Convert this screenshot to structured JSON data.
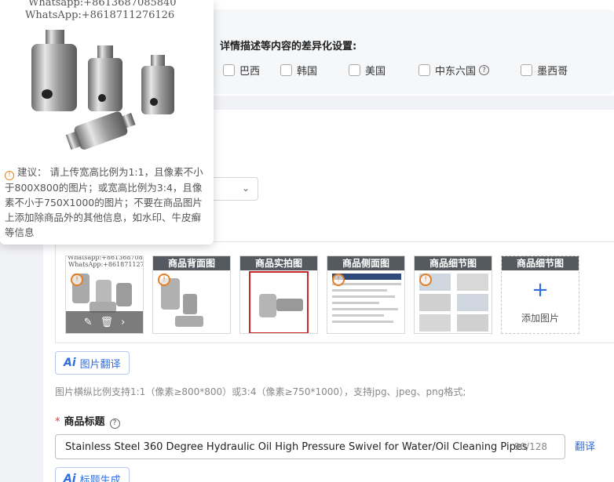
{
  "watermark": {
    "top": "Whatsapp:+8613687085840",
    "line": "WhatsApp:+8618711276126"
  },
  "tooltip": {
    "text": "建议： 请上传宽高比例为1:1，且像素不小于800X800的图片；或宽高比例为3:4，且像素不小于750X1000的图片；不要在商品图片上添加除商品外的其他信息，如水印、牛皮癣等信息"
  },
  "country_section": {
    "title": "详情描述等内容的差异化设置:",
    "options": [
      {
        "label": "巴西",
        "checked": false
      },
      {
        "label": "韩国",
        "checked": false
      },
      {
        "label": "美国",
        "checked": false
      },
      {
        "label": "中东六国",
        "checked": false,
        "help": true
      },
      {
        "label": "墨西哥",
        "checked": false
      }
    ]
  },
  "gallery": {
    "thumbs": [
      {
        "label": "",
        "type": "main"
      },
      {
        "label": "商品背面图",
        "type": "image"
      },
      {
        "label": "商品实拍图",
        "type": "image"
      },
      {
        "label": "商品侧面图",
        "type": "image"
      },
      {
        "label": "商品细节图",
        "type": "image"
      },
      {
        "label": "商品细节图",
        "type": "add",
        "add_text": "添加图片"
      }
    ]
  },
  "buttons": {
    "image_translate": "图片翻译",
    "title_generate": "标题生成",
    "ai_prefix": "Ai"
  },
  "hint": "图片横纵比例支持1:1（像素≥800*800）或3:4（像素≥750*1000），支持jpg、jpeg、png格式;",
  "product_title": {
    "label": "商品标题",
    "required_mark": "*",
    "value": "Stainless Steel 360 Degree Hydraulic Oil High Pressure Swivel for Water/Oil Cleaning Pipes",
    "counter": "90/128",
    "translate": "翻译"
  },
  "colors": {
    "accent": "#2f6de1",
    "required": "#e53935",
    "warning": "#e08a2c"
  }
}
